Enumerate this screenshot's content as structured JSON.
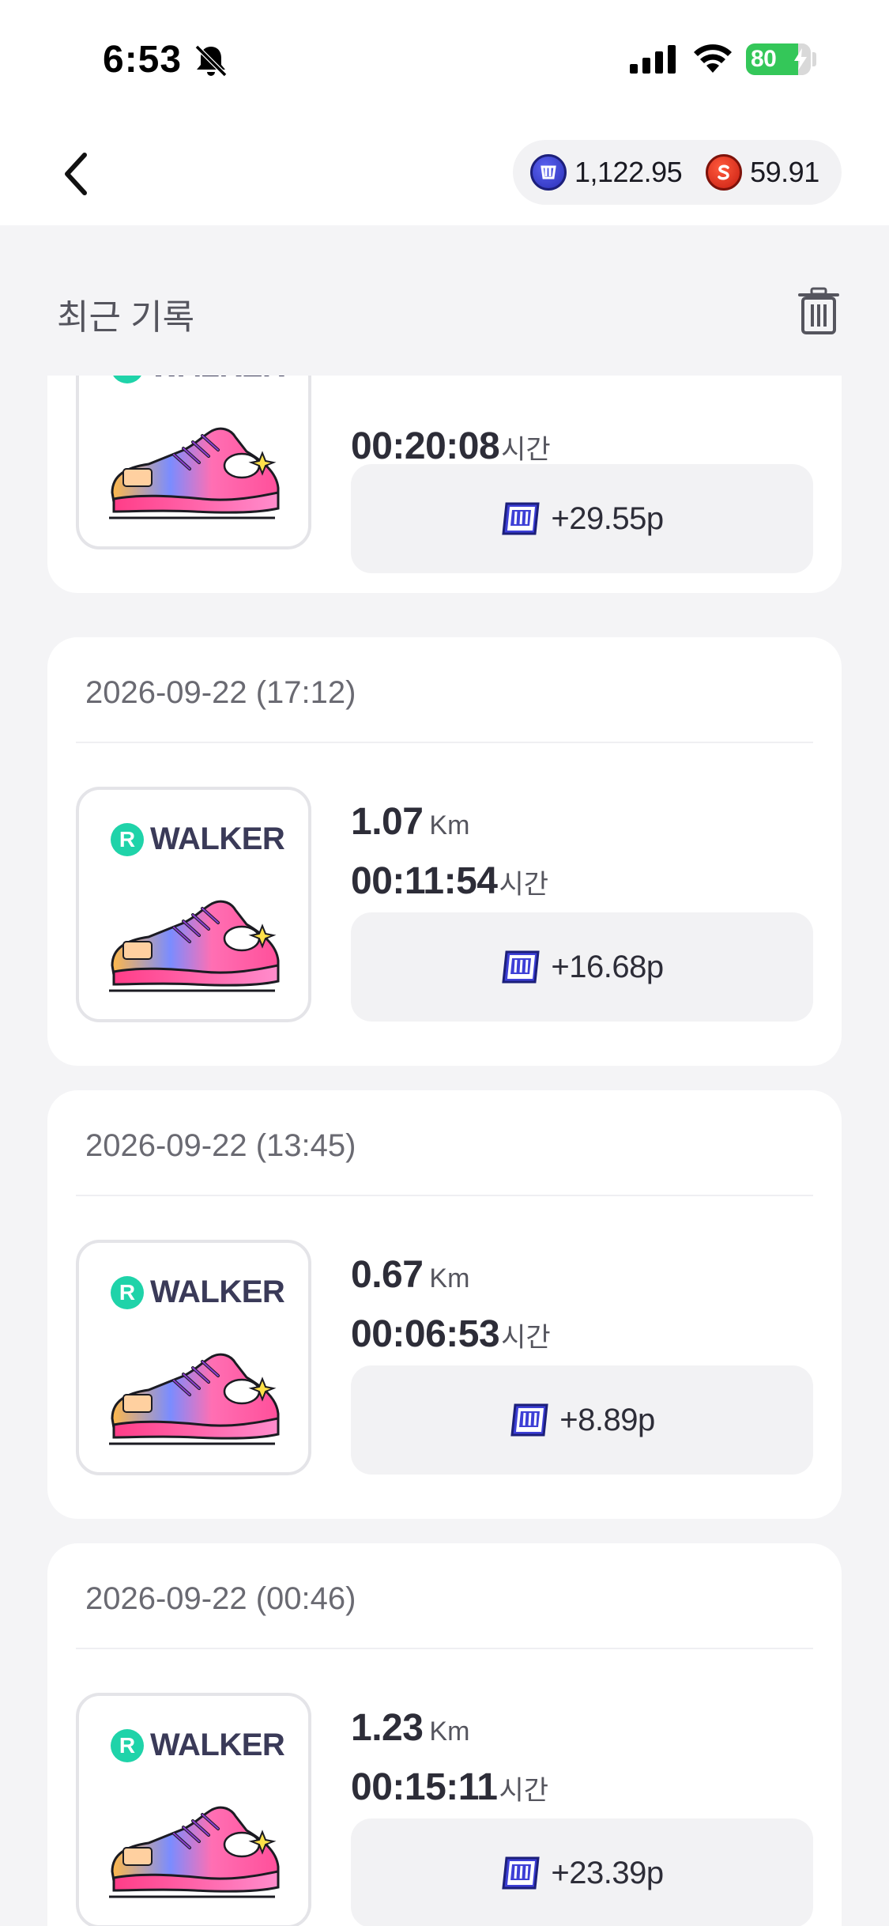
{
  "status_bar": {
    "time": "6:53",
    "battery": "80",
    "battery_level_percent": 80
  },
  "header": {
    "back_icon": "chevron-left-icon",
    "balances": [
      {
        "coin": "w-coin-icon",
        "value": "1,122.95",
        "color": "#2a2fb8"
      },
      {
        "coin": "s-coin-icon",
        "value": "59.91",
        "color": "#c81e12"
      }
    ]
  },
  "section": {
    "title": "최근 기록",
    "delete_icon": "trash-icon"
  },
  "records": [
    {
      "date": "",
      "distance": "",
      "distance_unit": "",
      "time": "00:20:08",
      "time_unit": "시간",
      "reward": "+29.55p",
      "brand": "WALKER",
      "brand_logo": "R"
    },
    {
      "date": "2026-09-22 (17:12)",
      "distance": "1.07",
      "distance_unit": "Km",
      "time": "00:11:54",
      "time_unit": "시간",
      "reward": "+16.68p",
      "brand": "WALKER",
      "brand_logo": "R"
    },
    {
      "date": "2026-09-22 (13:45)",
      "distance": "0.67",
      "distance_unit": "Km",
      "time": "00:06:53",
      "time_unit": "시간",
      "reward": "+8.89p",
      "brand": "WALKER",
      "brand_logo": "R"
    },
    {
      "date": "2026-09-22 (00:46)",
      "distance": "1.23",
      "distance_unit": "Km",
      "time": "00:15:11",
      "time_unit": "시간",
      "reward": "+23.39p",
      "brand": "WALKER",
      "brand_logo": "R"
    }
  ]
}
